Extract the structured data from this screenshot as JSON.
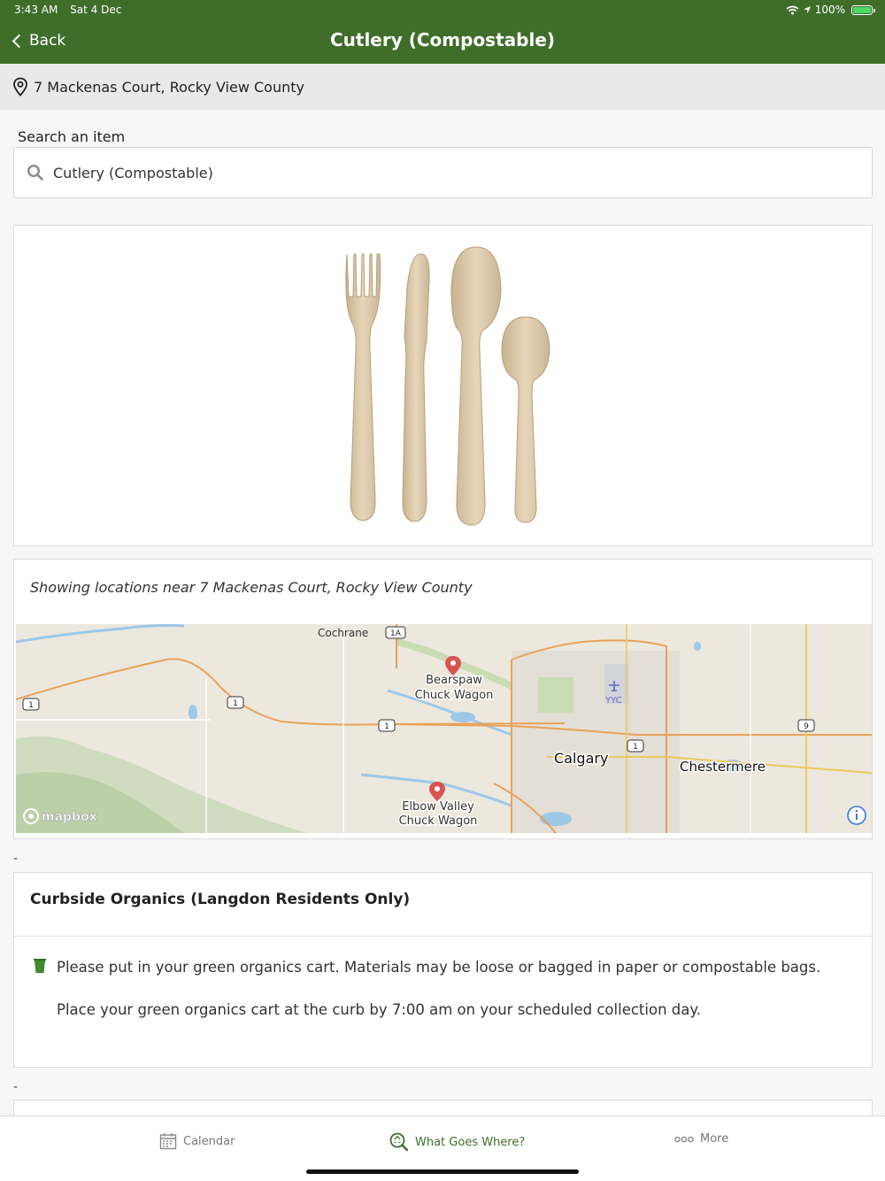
{
  "status_bar": {
    "time": "3:43 AM",
    "date": "Sat 4 Dec",
    "battery": "100%"
  },
  "nav": {
    "back_label": "Back",
    "title": "Cutlery (Compostable)"
  },
  "address": {
    "text": "7 Mackenas Court, Rocky View County"
  },
  "search": {
    "label": "Search an item",
    "value": "Cutlery (Compostable)"
  },
  "map_section": {
    "caption": "Showing locations near 7 Mackenas Court, Rocky View County",
    "labels": {
      "cochrane": "Cochrane",
      "bearspaw_1": "Bearspaw",
      "bearspaw_2": "Chuck Wagon",
      "elbow_1": "Elbow Valley",
      "elbow_2": "Chuck Wagon",
      "calgary": "Calgary",
      "chestermere": "Chestermere",
      "yyc": "YYC",
      "mapbox": "mapbox"
    },
    "shields": {
      "hwy1a": "1A",
      "hwy1_a": "1",
      "hwy1_b": "1",
      "hwy1_c": "1",
      "hwy1_d": "1",
      "hwy9": "9"
    }
  },
  "separator": "-",
  "info_card": {
    "title": "Curbside Organics (Langdon Residents Only)",
    "line1": "Please put in your green organics cart. Materials may be loose or bagged in paper or compostable bags.",
    "line2": "Place your green organics cart at the curb by 7:00 am on your scheduled collection day."
  },
  "tabs": [
    {
      "label": "Calendar",
      "icon": "calendar-icon"
    },
    {
      "label": "What Goes Where?",
      "icon": "recycle-search-icon"
    },
    {
      "label": "More",
      "icon": "more-dots-icon"
    }
  ],
  "colors": {
    "header_green": "#3f6e2b",
    "pin_red": "#d9534f",
    "road_orange": "#e8a25a"
  }
}
